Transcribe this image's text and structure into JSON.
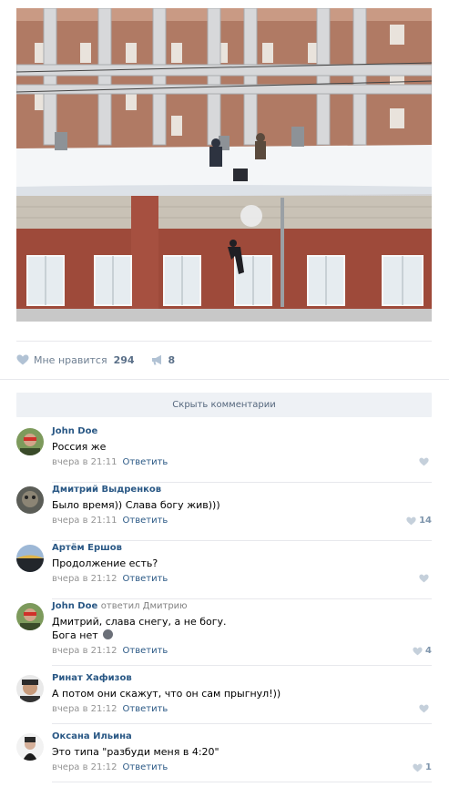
{
  "post": {
    "like_label": "Мне нравится",
    "like_count": "294",
    "share_count": "8"
  },
  "hide_comments_label": "Скрыть комментарии",
  "comments": [
    {
      "author": "John Doe",
      "reply_to": "",
      "text": "Россия же",
      "text2": "",
      "time": "вчера в 21:11",
      "reply": "Ответить",
      "likes": ""
    },
    {
      "author": "Дмитрий Выдренков",
      "reply_to": "",
      "text": "Было время)) Слава богу жив)))",
      "text2": "",
      "time": "вчера в 21:11",
      "reply": "Ответить",
      "likes": "14"
    },
    {
      "author": "Артём Ершов",
      "reply_to": "",
      "text": "Продолжение есть?",
      "text2": "",
      "time": "вчера в 21:12",
      "reply": "Ответить",
      "likes": ""
    },
    {
      "author": "John Doe",
      "reply_to": "ответил Дмитрию",
      "text": "Дмитрий, слава снегу, а не богу.",
      "text2": "Бога нет",
      "time": "вчера в 21:12",
      "reply": "Ответить",
      "likes": "4"
    },
    {
      "author": "Ринат Хафизов",
      "reply_to": "",
      "text": "А потом они скажут, что он сам прыгнул!))",
      "text2": "",
      "time": "вчера в 21:12",
      "reply": "Ответить",
      "likes": ""
    },
    {
      "author": "Оксана Ильина",
      "reply_to": "",
      "text": "Это типа \"разбуди меня в 4:20\"",
      "text2": "",
      "time": "вчера в 21:12",
      "reply": "Ответить",
      "likes": "1"
    }
  ],
  "colors": {
    "link": "#2a5885",
    "meta": "#939393",
    "button_bg": "#eef1f5"
  },
  "icons": [
    "heart-icon",
    "megaphone-icon",
    "emoji-icon"
  ]
}
